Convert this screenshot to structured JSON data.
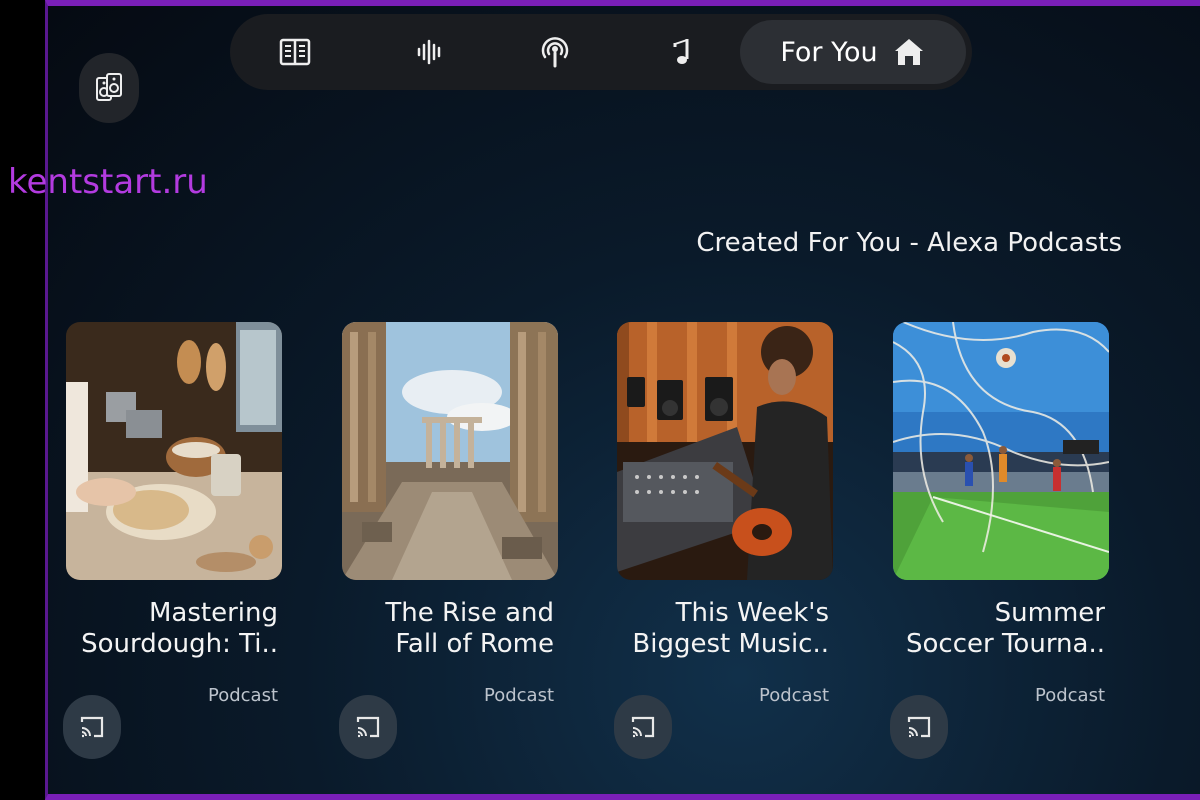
{
  "watermark": "kentstart.ru",
  "nav": {
    "items": [
      {
        "icon": "book-icon"
      },
      {
        "icon": "audio-wave-icon"
      },
      {
        "icon": "podcast-icon"
      },
      {
        "icon": "music-note-icon"
      },
      {
        "icon": "home-icon",
        "label": "For You",
        "selected": true
      }
    ]
  },
  "device": {
    "icon": "speaker-icon"
  },
  "section": {
    "title": "Created For You - Alexa Podcasts"
  },
  "cards": [
    {
      "title_line1": "Mastering",
      "title_line2": "Sourdough: Ti..",
      "subtitle": "Podcast",
      "image": "baking-kitchen-image"
    },
    {
      "title_line1": "The Rise and",
      "title_line2": "Fall of Rome",
      "subtitle": "Podcast",
      "image": "roman-ruins-image"
    },
    {
      "title_line1": "This Week's",
      "title_line2": "Biggest Music..",
      "subtitle": "Podcast",
      "image": "music-studio-image"
    },
    {
      "title_line1": "Summer",
      "title_line2": "Soccer Tourna..",
      "subtitle": "Podcast",
      "image": "soccer-match-image"
    }
  ],
  "colors": {
    "accent_border": "#7a1fb8",
    "watermark": "#b33be0",
    "nav_bg": "#1a1c20",
    "nav_selected_bg": "#2c2f34",
    "cast_button_bg": "#2e3a46"
  }
}
